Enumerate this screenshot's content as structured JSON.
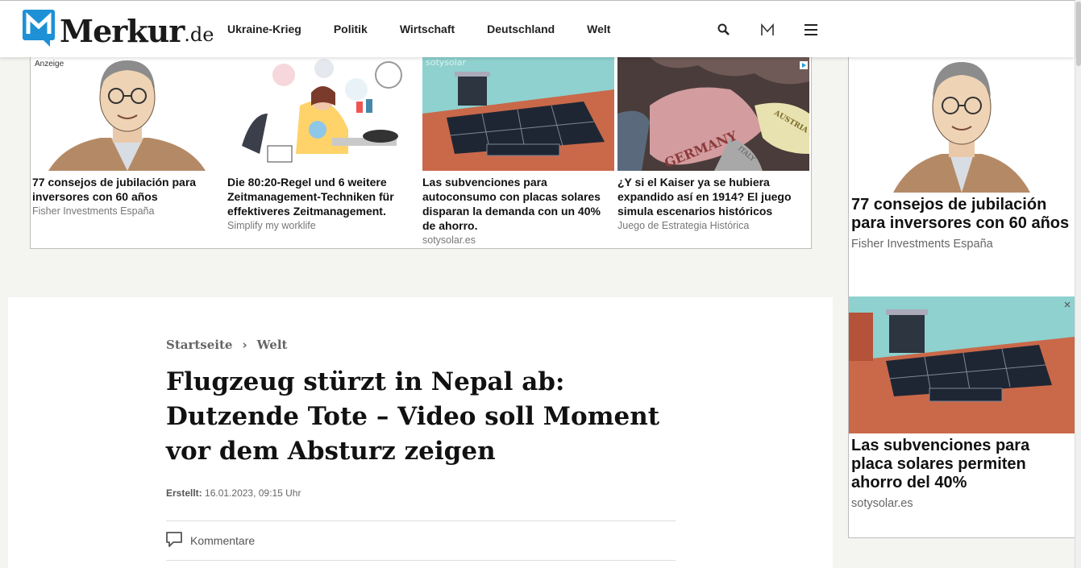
{
  "header": {
    "logo_text": "Merkur",
    "logo_tld": ".de",
    "nav": [
      "Ukraine-Krieg",
      "Politik",
      "Wirtschaft",
      "Deutschland",
      "Welt"
    ],
    "icons": [
      "search-icon",
      "merkur-m-icon",
      "hamburger-menu-icon"
    ]
  },
  "ads": {
    "label": "Anzeige",
    "cards": [
      {
        "title": "77 consejos de jubilación para inversores con 60 años",
        "source": "Fisher Investments España"
      },
      {
        "title": "Die 80:20-Regel und 6 weitere Zeitmanagement-Techniken für effektiveres Zeitmanagement.",
        "source": "Simplify my worklife"
      },
      {
        "title": "Las subvenciones para autoconsumo con placas solares disparan la demanda con un 40% de ahorro.",
        "source": "sotysolar.es"
      },
      {
        "title": "¿Y si el Kaiser ya se hubiera expandido así en 1914? El juego simula escenarios históricos",
        "source": "Juego de Estrategia Histórica"
      }
    ],
    "map_labels": {
      "germany": "GERMANY",
      "austria": "AUSTRIA HUNGARY",
      "italy": "ITALY"
    },
    "solar_watermark": "sotysolar"
  },
  "sidebar": {
    "cards": [
      {
        "title": "77 consejos de jubilación para inversores con 60 años",
        "source": "Fisher Investments España"
      },
      {
        "title": "Las subvenciones para placa solares permiten ahorro del 40%",
        "source": "sotysolar.es"
      }
    ]
  },
  "article": {
    "breadcrumb": [
      "Startseite",
      "Welt"
    ],
    "breadcrumb_separator": "›",
    "headline": "Flugzeug stürzt in Nepal ab: Dutzende Tote – Video soll Moment vor dem Absturz zeigen",
    "meta_label": "Erstellt:",
    "meta_value": "16.01.2023, 09:15 Uhr",
    "comments_label": "Kommentare"
  },
  "colors": {
    "brand_blue": "#1e90d6",
    "roof": "#c9694a",
    "sky": "#8ed1cf",
    "map_de": "#d39c9f"
  }
}
